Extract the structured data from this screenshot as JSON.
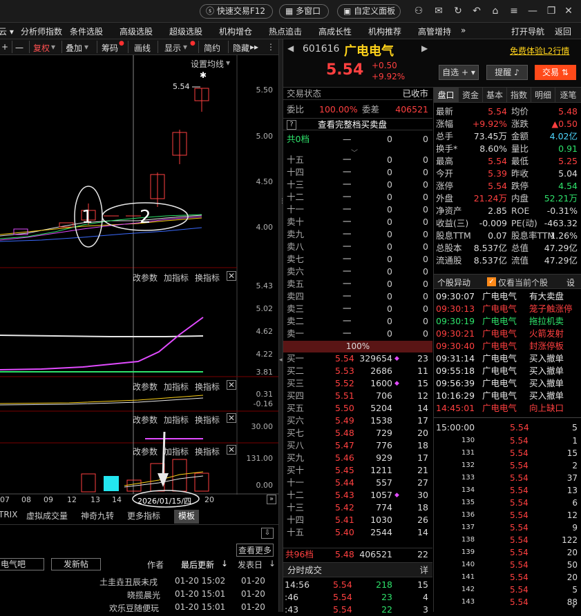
{
  "topbar": {
    "quick_trade": "快速交易F12",
    "multi_window": "多窗口",
    "custom_panel": "自定义面板"
  },
  "menu": [
    "云 ▾",
    "分析师指数",
    "条件选股",
    "高级选股",
    "超级选股",
    "机构增仓",
    "热点追击",
    "高成长性",
    "机构推荐",
    "高管增持",
    "»",
    "打开导航",
    "返回"
  ],
  "toolbar": [
    "+",
    "一",
    "复权",
    "叠加",
    "筹码",
    "画线",
    "显示",
    "简约",
    "隐藏"
  ],
  "chart": {
    "ma_setting": "设置均线",
    "price_mark": "5.54",
    "price_axis": [
      "5.50",
      "5.00",
      "4.50",
      "4.00"
    ],
    "annot_1": "1",
    "annot_2": "2",
    "panel_btns": [
      "改参数",
      "加指标",
      "换指标"
    ],
    "p2_axis": [
      "5.43",
      "5.02",
      "4.62",
      "4.22",
      "3.81"
    ],
    "p3_axis": [
      "0.31",
      "-0.16"
    ],
    "p4_axis": [
      "30.00"
    ],
    "p5_axis": [
      "131.00",
      "0.00"
    ],
    "dates": [
      "07",
      "08",
      "09",
      "12",
      "13",
      "14",
      "2026/01/15/四",
      "20"
    ],
    "bottom_tabs": [
      "TRIX",
      "虚拟成交量",
      "神奇九转",
      "更多指标",
      "模板"
    ]
  },
  "lower": {
    "more": "查看更多",
    "forum": "电气吧",
    "new_post": "发新帖",
    "author": "作者",
    "last_update": "最后更新",
    "post_date": "发表日",
    "posts": [
      {
        "author": "土圭垚丑辰未戌",
        "update": "01-20 15:02",
        "date": "01-20"
      },
      {
        "author": "晓揽晨光",
        "update": "01-20 15:01",
        "date": "01-20"
      },
      {
        "author": "欢乐豆随便玩",
        "update": "01-20 15:01",
        "date": "01-20"
      }
    ]
  },
  "stock": {
    "code": "601616",
    "name": "广电电气",
    "price": "5.54",
    "change": "+0.50",
    "pct": "+9.92%",
    "trial": "免费体验L2行情",
    "btn_watch": "自选",
    "btn_alert": "提醒",
    "btn_trade": "交易"
  },
  "orderbook": {
    "status_label": "交易状态",
    "status_value": "已收市",
    "ratio_label": "委比",
    "ratio_value": "100.00%",
    "diff_label": "委差",
    "diff_value": "406521",
    "full_btn": "查看完整档买卖盘",
    "total0": "共0档",
    "sells": [
      {
        "l": "十五",
        "p": "一",
        "v": "0",
        "n": "0"
      },
      {
        "l": "十四",
        "p": "一",
        "v": "0",
        "n": "0"
      },
      {
        "l": "十三",
        "p": "一",
        "v": "0",
        "n": "0"
      },
      {
        "l": "十二",
        "p": "一",
        "v": "0",
        "n": "0"
      },
      {
        "l": "十一",
        "p": "一",
        "v": "0",
        "n": "0"
      },
      {
        "l": "卖十",
        "p": "一",
        "v": "0",
        "n": "0"
      },
      {
        "l": "卖九",
        "p": "一",
        "v": "0",
        "n": "0"
      },
      {
        "l": "卖八",
        "p": "一",
        "v": "0",
        "n": "0"
      },
      {
        "l": "卖七",
        "p": "一",
        "v": "0",
        "n": "0"
      },
      {
        "l": "卖六",
        "p": "一",
        "v": "0",
        "n": "0"
      },
      {
        "l": "卖五",
        "p": "一",
        "v": "0",
        "n": "0"
      },
      {
        "l": "卖四",
        "p": "一",
        "v": "0",
        "n": "0"
      },
      {
        "l": "卖三",
        "p": "一",
        "v": "0",
        "n": "0"
      },
      {
        "l": "卖二",
        "p": "一",
        "v": "0",
        "n": "0"
      },
      {
        "l": "卖一",
        "p": "一",
        "v": "0",
        "n": "0"
      }
    ],
    "bar_pct": "100%",
    "buys": [
      {
        "l": "买一",
        "p": "5.54",
        "v": "329654",
        "n": "23",
        "dot": true
      },
      {
        "l": "买二",
        "p": "5.53",
        "v": "2686",
        "n": "11"
      },
      {
        "l": "买三",
        "p": "5.52",
        "v": "1600",
        "n": "15",
        "dot": true
      },
      {
        "l": "买四",
        "p": "5.51",
        "v": "706",
        "n": "12"
      },
      {
        "l": "买五",
        "p": "5.50",
        "v": "5204",
        "n": "14"
      },
      {
        "l": "买六",
        "p": "5.49",
        "v": "1538",
        "n": "17"
      },
      {
        "l": "买七",
        "p": "5.48",
        "v": "729",
        "n": "20"
      },
      {
        "l": "买八",
        "p": "5.47",
        "v": "776",
        "n": "18"
      },
      {
        "l": "买九",
        "p": "5.46",
        "v": "929",
        "n": "17"
      },
      {
        "l": "买十",
        "p": "5.45",
        "v": "1211",
        "n": "21"
      },
      {
        "l": "十一",
        "p": "5.44",
        "v": "557",
        "n": "27"
      },
      {
        "l": "十二",
        "p": "5.43",
        "v": "1057",
        "n": "30",
        "dot": true
      },
      {
        "l": "十三",
        "p": "5.42",
        "v": "774",
        "n": "18"
      },
      {
        "l": "十四",
        "p": "5.41",
        "v": "1030",
        "n": "26"
      },
      {
        "l": "十五",
        "p": "5.40",
        "v": "2544",
        "n": "14"
      }
    ],
    "total96": "共96档",
    "total96_p": "5.48",
    "total96_v": "406521",
    "total96_n": "22",
    "tick_title": "分时成交",
    "tick_btn": "详",
    "ticks": [
      {
        "t": "14:56",
        "p": "5.54",
        "v": "218",
        "n": "15"
      },
      {
        "t": ":46",
        "p": "5.54",
        "v": "23",
        "n": "4"
      },
      {
        "t": ":43",
        "p": "5.54",
        "v": "22",
        "n": "3"
      }
    ]
  },
  "quote": {
    "tabs": [
      "盘口",
      "资金",
      "基本",
      "指数",
      "明细",
      "逐笔"
    ],
    "rows": [
      [
        "最新",
        "5.54",
        "均价",
        "5.48"
      ],
      [
        "涨幅",
        "+9.92%",
        "涨跌",
        "▲0.50"
      ],
      [
        "总手",
        "73.45万",
        "金额",
        "4.02亿"
      ],
      [
        "换手*",
        "8.60%",
        "量比",
        "0.91"
      ],
      [
        "最高",
        "5.54",
        "最低",
        "5.25"
      ],
      [
        "今开",
        "5.39",
        "昨收",
        "5.04"
      ],
      [
        "涨停",
        "5.54",
        "跌停",
        "4.54"
      ],
      [
        "外盘",
        "21.24万",
        "内盘",
        "52.21万"
      ],
      [
        "净资产",
        "2.85",
        "ROE",
        "-0.31%"
      ],
      [
        "收益(三)",
        "-0.009",
        "PE(动)",
        "-463.32"
      ],
      [
        "股息TTM",
        "0.07",
        "股息率TTM",
        "1.26%"
      ],
      [
        "总股本",
        "8.537亿",
        "总值",
        "47.29亿"
      ],
      [
        "流通股",
        "8.537亿",
        "流值",
        "47.29亿"
      ]
    ],
    "anomaly_title": "个股异动",
    "anomaly_check": "仅看当前个股",
    "anomaly_btn": "设",
    "anomalies": [
      {
        "t": "09:30:07",
        "n": "广电电气",
        "e": "有大卖盘",
        "c": "w"
      },
      {
        "t": "09:30:13",
        "n": "广电电气",
        "e": "笼子触涨停",
        "c": "r"
      },
      {
        "t": "09:30:19",
        "n": "广电电气",
        "e": "拖拉机卖",
        "c": "g"
      },
      {
        "t": "09:30:21",
        "n": "广电电气",
        "e": "火箭发射",
        "c": "r"
      },
      {
        "t": "09:30:40",
        "n": "广电电气",
        "e": "封涨停板",
        "c": "r"
      },
      {
        "t": "09:31:14",
        "n": "广电电气",
        "e": "买入撤单",
        "c": "w"
      },
      {
        "t": "09:55:18",
        "n": "广电电气",
        "e": "买入撤单",
        "c": "w"
      },
      {
        "t": "09:56:39",
        "n": "广电电气",
        "e": "买入撤单",
        "c": "w"
      },
      {
        "t": "10:16:29",
        "n": "广电电气",
        "e": "买入撤单",
        "c": "w"
      },
      {
        "t": "14:45:01",
        "n": "广电电气",
        "e": "向上缺口",
        "c": "r"
      }
    ],
    "trades_head": {
      "t": "15:00:00",
      "p": "5.54",
      "v": "5"
    },
    "trades": [
      {
        "t": "130",
        "p": "5.54",
        "v": "1"
      },
      {
        "t": "131",
        "p": "5.54",
        "v": "15"
      },
      {
        "t": "132",
        "p": "5.54",
        "v": "2"
      },
      {
        "t": "133",
        "p": "5.54",
        "v": "37"
      },
      {
        "t": "134",
        "p": "5.54",
        "v": "13"
      },
      {
        "t": "135",
        "p": "5.54",
        "v": "6"
      },
      {
        "t": "136",
        "p": "5.54",
        "v": "12"
      },
      {
        "t": "137",
        "p": "5.54",
        "v": "9"
      },
      {
        "t": "138",
        "p": "5.54",
        "v": "122"
      },
      {
        "t": "139",
        "p": "5.54",
        "v": "20"
      },
      {
        "t": "140",
        "p": "5.54",
        "v": "50"
      },
      {
        "t": "141",
        "p": "5.54",
        "v": "20"
      },
      {
        "t": "142",
        "p": "5.54",
        "v": "5"
      },
      {
        "t": "143",
        "p": "5.54",
        "v": "88"
      }
    ]
  },
  "colors": {
    "up": "#ff4040",
    "down": "#2ee36b",
    "accent": "#ffd31a",
    "macd": "#e14bff"
  }
}
